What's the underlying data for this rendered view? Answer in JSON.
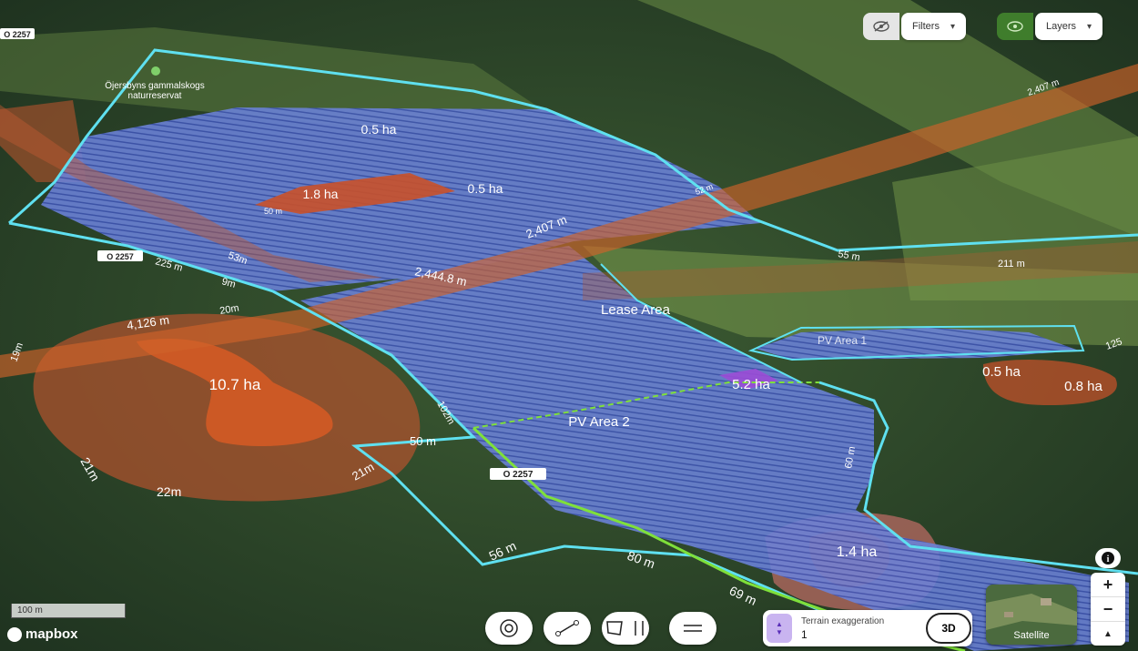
{
  "map": {
    "reserve_name_line1": "Öjersbyns gammalskogs",
    "reserve_name_line2": "naturreservat",
    "road_badges": [
      "O 2257",
      "O 2257",
      "O 2257"
    ],
    "area_labels": {
      "lease_area": "Lease Area",
      "pv_area_1": "PV Area 1",
      "pv_area_2": "PV Area 2"
    },
    "hectare_labels": [
      "0.5 ha",
      "1.8 ha",
      "0.5 ha",
      "10.7 ha",
      "5.2 ha",
      "0.5 ha",
      "0.8 ha",
      "1.4 ha"
    ],
    "distance_labels": [
      "2,407 m",
      "2,444.8 m",
      "4,126 m",
      "2,407 m",
      "50 m",
      "102m",
      "21m",
      "22m",
      "21m",
      "56 m",
      "80 m",
      "69 m",
      "60 m",
      "55 m",
      "211 m",
      "53m",
      "225 m",
      "9m",
      "20m",
      "19m",
      "50 m",
      "52 m",
      "125"
    ],
    "colors": {
      "pv_blue": "#7a8fe0",
      "exclusion_orange": "#c2502a",
      "boundary_cyan": "#5fe0f0",
      "cable_green": "#7fe03a",
      "purple": "#9b4dd6"
    }
  },
  "controls": {
    "filters_label": "Filters",
    "layers_label": "Layers",
    "terrain_label": "Terrain exaggeration",
    "terrain_value": "1",
    "btn_3d": "3D",
    "satellite_label": "Satellite",
    "zoom_in": "+",
    "zoom_out": "−",
    "compass": "▲",
    "scale_label": "100 m",
    "attribution": "mapbox",
    "info": "i"
  },
  "icons": {
    "filters_toggle": "eye-off-icon",
    "layers_toggle": "eye-icon",
    "tools": [
      "circle-target-icon",
      "measure-line-icon",
      "polygon-icon",
      "vertical-measure-icon",
      "horizontal-measure-icon"
    ]
  }
}
